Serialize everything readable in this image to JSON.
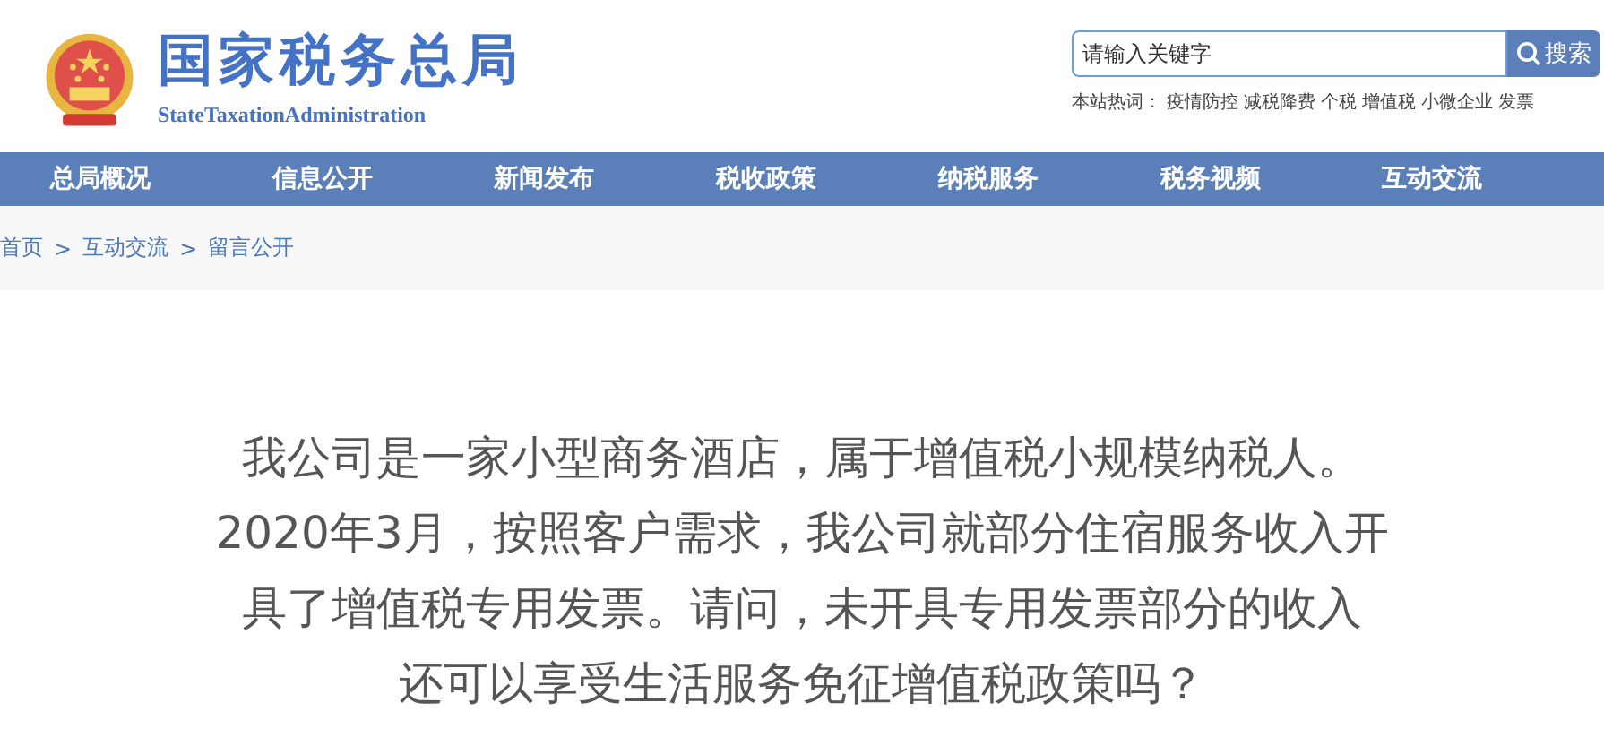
{
  "header": {
    "logo_title": "国家税务总局",
    "logo_subtitle": "StateTaxationAdministration"
  },
  "search": {
    "placeholder": "请输入关键字",
    "button": "搜索",
    "hot_label": "本站热词：",
    "hot_words": [
      "疫情防控",
      "减税降费",
      "个税",
      "增值税",
      "小微企业",
      "发票"
    ]
  },
  "nav": [
    "总局概况",
    "信息公开",
    "新闻发布",
    "税收政策",
    "纳税服务",
    "税务视频",
    "互动交流"
  ],
  "breadcrumb": {
    "separator": ">",
    "items": [
      "首页",
      "互动交流",
      "留言公开"
    ]
  },
  "question": {
    "lines": [
      "我公司是一家小型商务酒店，属于增值税小规模纳税人。",
      "2020年3月，按照客户需求，我公司就部分住宿服务收入开",
      "具了增值税专用发票。请问，未开具专用发票部分的收入",
      "还可以享受生活服务免征增值税政策吗？"
    ]
  }
}
